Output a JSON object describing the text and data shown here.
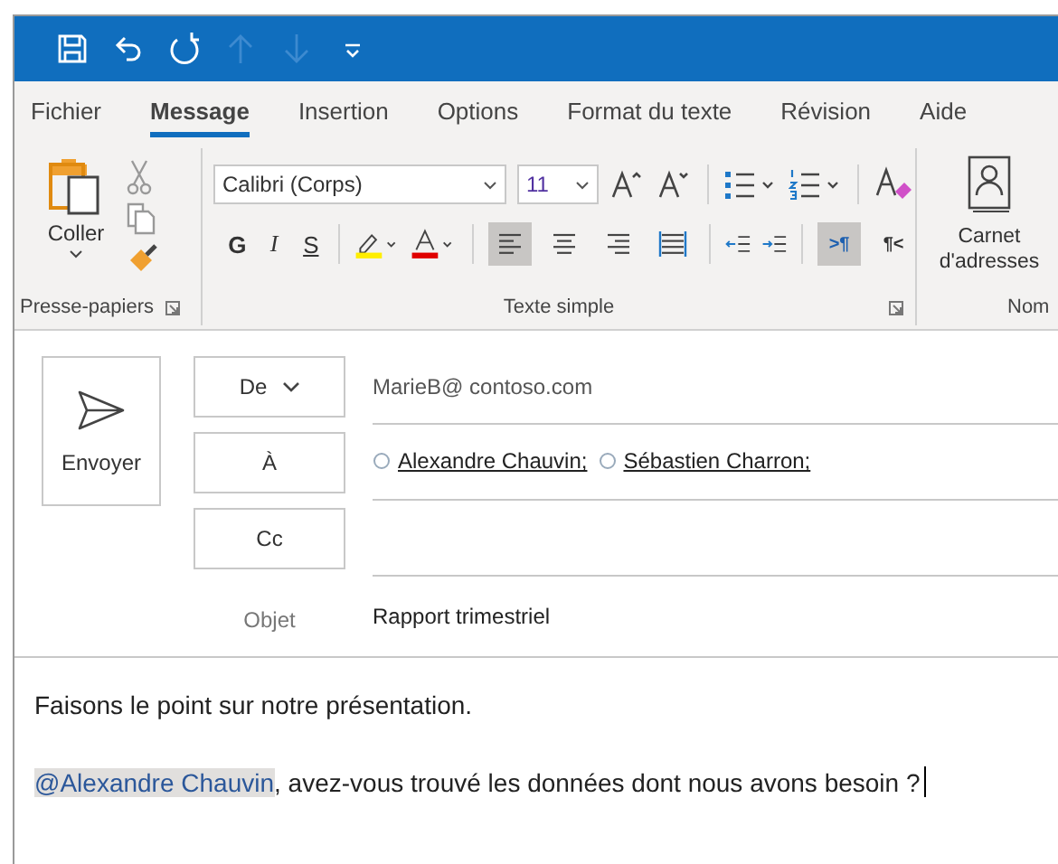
{
  "quick_access": [
    {
      "kind": "save",
      "disabled": false
    },
    {
      "kind": "undo",
      "disabled": false
    },
    {
      "kind": "redo",
      "disabled": false
    },
    {
      "kind": "up",
      "disabled": true
    },
    {
      "kind": "down",
      "disabled": true
    },
    {
      "kind": "customize",
      "disabled": false
    }
  ],
  "tabs": [
    {
      "label": "Fichier",
      "selected": false
    },
    {
      "label": "Message",
      "selected": true
    },
    {
      "label": "Insertion",
      "selected": false
    },
    {
      "label": "Options",
      "selected": false
    },
    {
      "label": "Format du texte",
      "selected": false
    },
    {
      "label": "Révision",
      "selected": false
    },
    {
      "label": "Aide",
      "selected": false
    }
  ],
  "ribbon": {
    "clipboard": {
      "paste": "Coller",
      "label": "Presse-papiers"
    },
    "text": {
      "font": "Calibri (Corps)",
      "size": "11",
      "label": "Texte simple",
      "styles": [
        {
          "kind": "bold",
          "label": "G"
        },
        {
          "kind": "italic",
          "label": "I"
        },
        {
          "kind": "underline",
          "label": "S"
        }
      ],
      "alignment": [
        {
          "kind": "left",
          "selected": true
        },
        {
          "kind": "center",
          "selected": false
        },
        {
          "kind": "right",
          "selected": false
        },
        {
          "kind": "justify",
          "selected": false
        }
      ],
      "direction": [
        {
          "kind": "ltr",
          "label": ">¶",
          "selected": true
        },
        {
          "kind": "rtl",
          "label": "¶<",
          "selected": false
        }
      ]
    },
    "names": {
      "address_book": "Carnet d'adresses",
      "label": "Nom"
    }
  },
  "compose": {
    "send": "Envoyer",
    "from": {
      "label": "De",
      "value": "MarieB@ contoso.com"
    },
    "to": {
      "label": "À",
      "recipients": [
        "Alexandre Chauvin;",
        "Sébastien Charron;"
      ]
    },
    "cc": {
      "label": "Cc"
    },
    "subject": {
      "label": "Objet",
      "value": "Rapport trimestriel"
    }
  },
  "body": {
    "paragraphs": [
      {
        "text": "Faisons le point sur notre présentation."
      },
      {
        "mention": "@Alexandre Chauvin",
        "text": ", avez-vous trouvé les données dont nous avons besoin ?"
      }
    ]
  }
}
